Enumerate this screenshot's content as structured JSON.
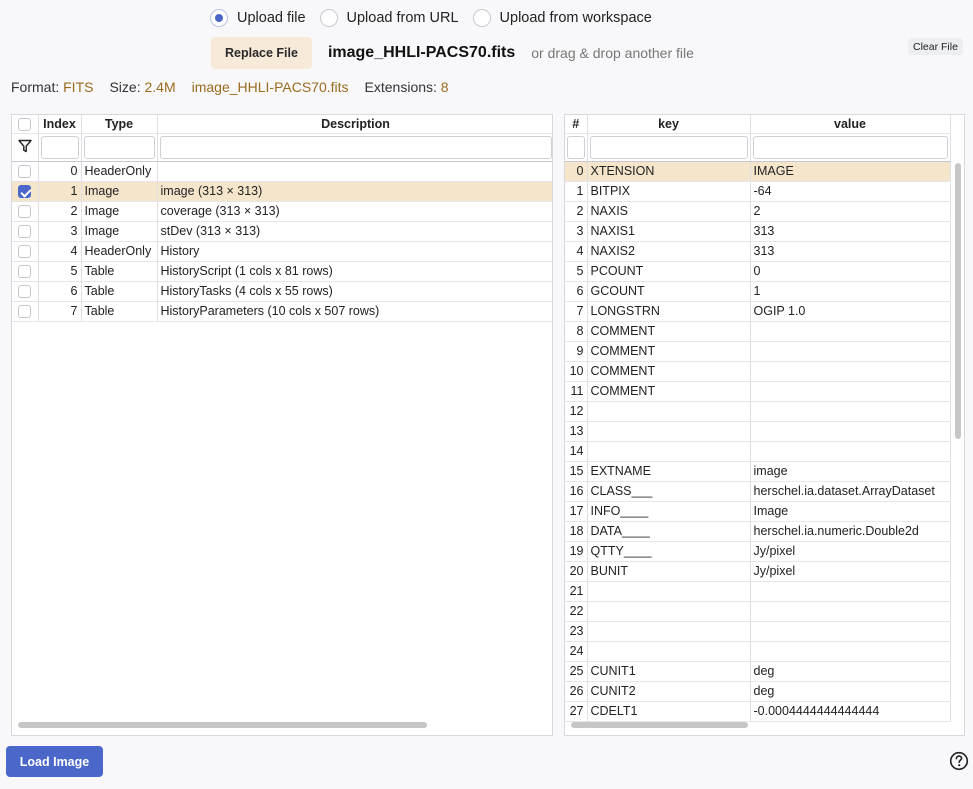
{
  "upload": {
    "options": [
      {
        "label": "Upload file",
        "selected": true
      },
      {
        "label": "Upload from URL",
        "selected": false
      },
      {
        "label": "Upload from workspace",
        "selected": false
      }
    ],
    "replace_label": "Replace File",
    "file_name": "image_HHLI-PACS70.fits",
    "drag_hint": "or drag & drop another file",
    "clear_label": "Clear File"
  },
  "info": {
    "format_label": "Format:",
    "format_value": "FITS",
    "size_label": "Size:",
    "size_value": "2.4M",
    "file_name": "image_HHLI-PACS70.fits",
    "extensions_label": "Extensions:",
    "extensions_value": "8"
  },
  "extensions_table": {
    "columns": [
      "Index",
      "Type",
      "Description"
    ],
    "rows": [
      {
        "index": "0",
        "type": "HeaderOnly",
        "description": "",
        "checked": false
      },
      {
        "index": "1",
        "type": "Image",
        "description": "image (313 × 313)",
        "checked": true
      },
      {
        "index": "2",
        "type": "Image",
        "description": "coverage (313 × 313)",
        "checked": false
      },
      {
        "index": "3",
        "type": "Image",
        "description": "stDev (313 × 313)",
        "checked": false
      },
      {
        "index": "4",
        "type": "HeaderOnly",
        "description": "History",
        "checked": false
      },
      {
        "index": "5",
        "type": "Table",
        "description": "HistoryScript (1 cols x 81 rows)",
        "checked": false
      },
      {
        "index": "6",
        "type": "Table",
        "description": "HistoryTasks (4 cols x 55 rows)",
        "checked": false
      },
      {
        "index": "7",
        "type": "Table",
        "description": "HistoryParameters (10 cols x 507 rows)",
        "checked": false
      }
    ]
  },
  "header_table": {
    "columns": [
      "#",
      "key",
      "value"
    ],
    "rows": [
      {
        "n": "0",
        "key": "XTENSION",
        "value": "IMAGE"
      },
      {
        "n": "1",
        "key": "BITPIX",
        "value": "-64"
      },
      {
        "n": "2",
        "key": "NAXIS",
        "value": "2"
      },
      {
        "n": "3",
        "key": "NAXIS1",
        "value": "313"
      },
      {
        "n": "4",
        "key": "NAXIS2",
        "value": "313"
      },
      {
        "n": "5",
        "key": "PCOUNT",
        "value": "0"
      },
      {
        "n": "6",
        "key": "GCOUNT",
        "value": "1"
      },
      {
        "n": "7",
        "key": "LONGSTRN",
        "value": "OGIP 1.0"
      },
      {
        "n": "8",
        "key": "COMMENT",
        "value": ""
      },
      {
        "n": "9",
        "key": "COMMENT",
        "value": ""
      },
      {
        "n": "10",
        "key": "COMMENT",
        "value": ""
      },
      {
        "n": "11",
        "key": "COMMENT",
        "value": ""
      },
      {
        "n": "12",
        "key": "",
        "value": ""
      },
      {
        "n": "13",
        "key": "",
        "value": ""
      },
      {
        "n": "14",
        "key": "",
        "value": ""
      },
      {
        "n": "15",
        "key": "EXTNAME",
        "value": "image"
      },
      {
        "n": "16",
        "key": "CLASS___",
        "value": "herschel.ia.dataset.ArrayDataset"
      },
      {
        "n": "17",
        "key": "INFO____",
        "value": "Image"
      },
      {
        "n": "18",
        "key": "DATA____",
        "value": "herschel.ia.numeric.Double2d"
      },
      {
        "n": "19",
        "key": "QTTY____",
        "value": "Jy/pixel"
      },
      {
        "n": "20",
        "key": "BUNIT",
        "value": "Jy/pixel"
      },
      {
        "n": "21",
        "key": "",
        "value": ""
      },
      {
        "n": "22",
        "key": "",
        "value": ""
      },
      {
        "n": "23",
        "key": "",
        "value": ""
      },
      {
        "n": "24",
        "key": "",
        "value": ""
      },
      {
        "n": "25",
        "key": "CUNIT1",
        "value": "deg"
      },
      {
        "n": "26",
        "key": "CUNIT2",
        "value": "deg"
      },
      {
        "n": "27",
        "key": "CDELT1",
        "value": "-0.0004444444444444"
      }
    ]
  },
  "footer": {
    "load_label": "Load Image",
    "help_icon": "question-circle-icon"
  },
  "colors": {
    "accent": "#4a67c9",
    "selected_row": "#f5e6cb",
    "info_value": "#9a6b1e",
    "replace_button": "#f7ead8"
  }
}
